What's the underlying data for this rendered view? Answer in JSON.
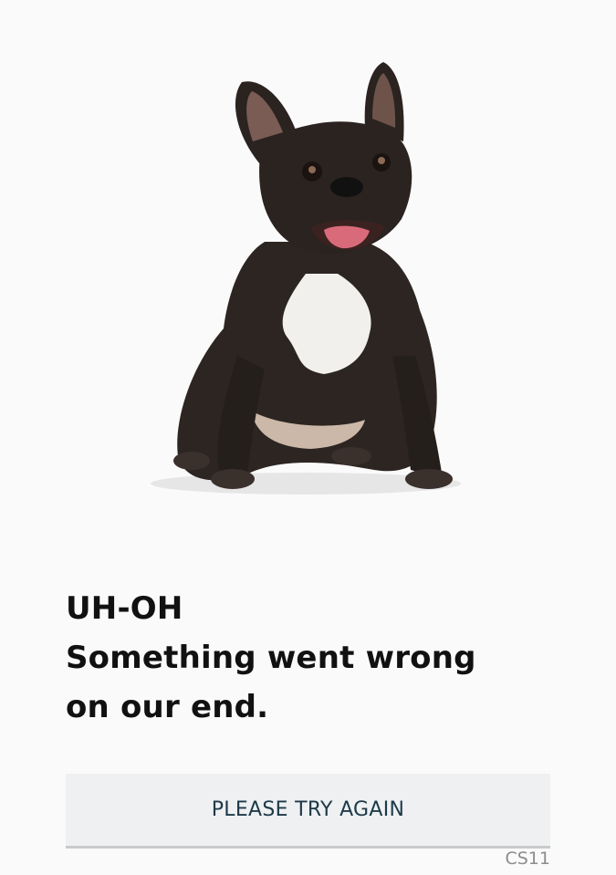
{
  "image": {
    "subject": "dog-photo",
    "alt": ""
  },
  "message": {
    "line1": "UH-OH",
    "line2": "Something went wrong",
    "line3": "on our end."
  },
  "button": {
    "label": "PLEASE TRY AGAIN"
  },
  "error_code": "CS11",
  "colors": {
    "background": "#fafafa",
    "button_background": "#eef0f2",
    "button_text": "#1d3a48",
    "heading_text": "#111111",
    "code_text": "#8a8c8e"
  }
}
